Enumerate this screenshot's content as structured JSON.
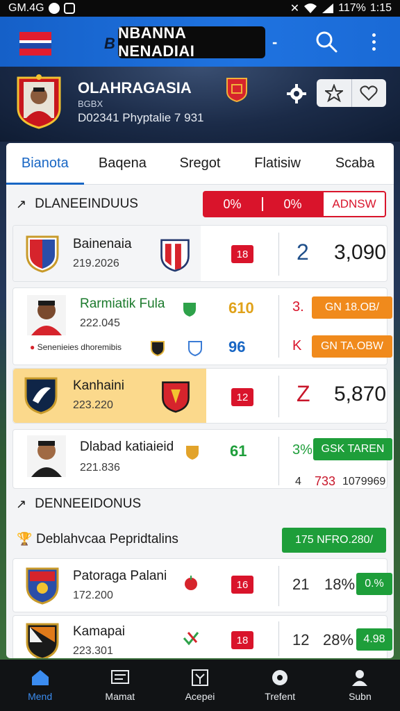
{
  "status": {
    "left": "GM.4G",
    "battery": "117%",
    "time": "1:15"
  },
  "appbar": {
    "brand_mark": "B",
    "title": "NBANNA NENADIAI",
    "caret": "-"
  },
  "hero": {
    "name": "OLAHRAGASIA",
    "sub": "BGBX",
    "meta": "D02341 Phyptalie 7 931"
  },
  "tabs": [
    "Bianota",
    "Baqena",
    "Sregot",
    "Flatisiw",
    "Scaba"
  ],
  "section1": {
    "title": "DLANEEINDUUS",
    "filter_a": "0%",
    "filter_b": "0%",
    "filter_btn": "ADNSW"
  },
  "rows": [
    {
      "name": "Bainenaia",
      "date": "219.2026",
      "badge": "18",
      "big": "2",
      "score": "3,090"
    },
    {
      "name": "Rarmiatik Fula",
      "date": "222.045",
      "tag": "Senenieies dhoremibis",
      "mid_a": "610",
      "mid_b": "96",
      "right_a": "3.",
      "right_b": "K",
      "pill_a": "GN 18.OB/",
      "pill_b": "GN TA.OBW"
    },
    {
      "name": "Kanhaini",
      "date": "223.220",
      "badge": "12",
      "big": "Z",
      "score": "5,870"
    },
    {
      "name": "Dlabad katiaieid",
      "date": "221.836",
      "mid_a": "61",
      "pct": "3%",
      "pill": "GSK TAREN",
      "foot_a": "4",
      "foot_b": "733",
      "foot_c": "1079969"
    }
  ],
  "section2": {
    "title": "DENNEEIDONUS"
  },
  "subsection": {
    "title": "Deblahvcaa Pepridtalins",
    "pill": "175 NFRO.280/"
  },
  "rows2": [
    {
      "name": "Patoraga Palani",
      "date": "172.200",
      "badge": "16",
      "num": "21",
      "pct": "18%",
      "pill": "0.%"
    },
    {
      "name": "Kamapai",
      "date": "223.301",
      "badge": "18",
      "num": "12",
      "pct": "28%",
      "pill": "4.98"
    }
  ],
  "nav": [
    "Mend",
    "Mamat",
    "Acepei",
    "Trefent",
    "Subn"
  ],
  "colors": {
    "accent": "#1866c4",
    "red": "#d9142b",
    "green": "#1e9e3a",
    "orange": "#f08a1c"
  }
}
